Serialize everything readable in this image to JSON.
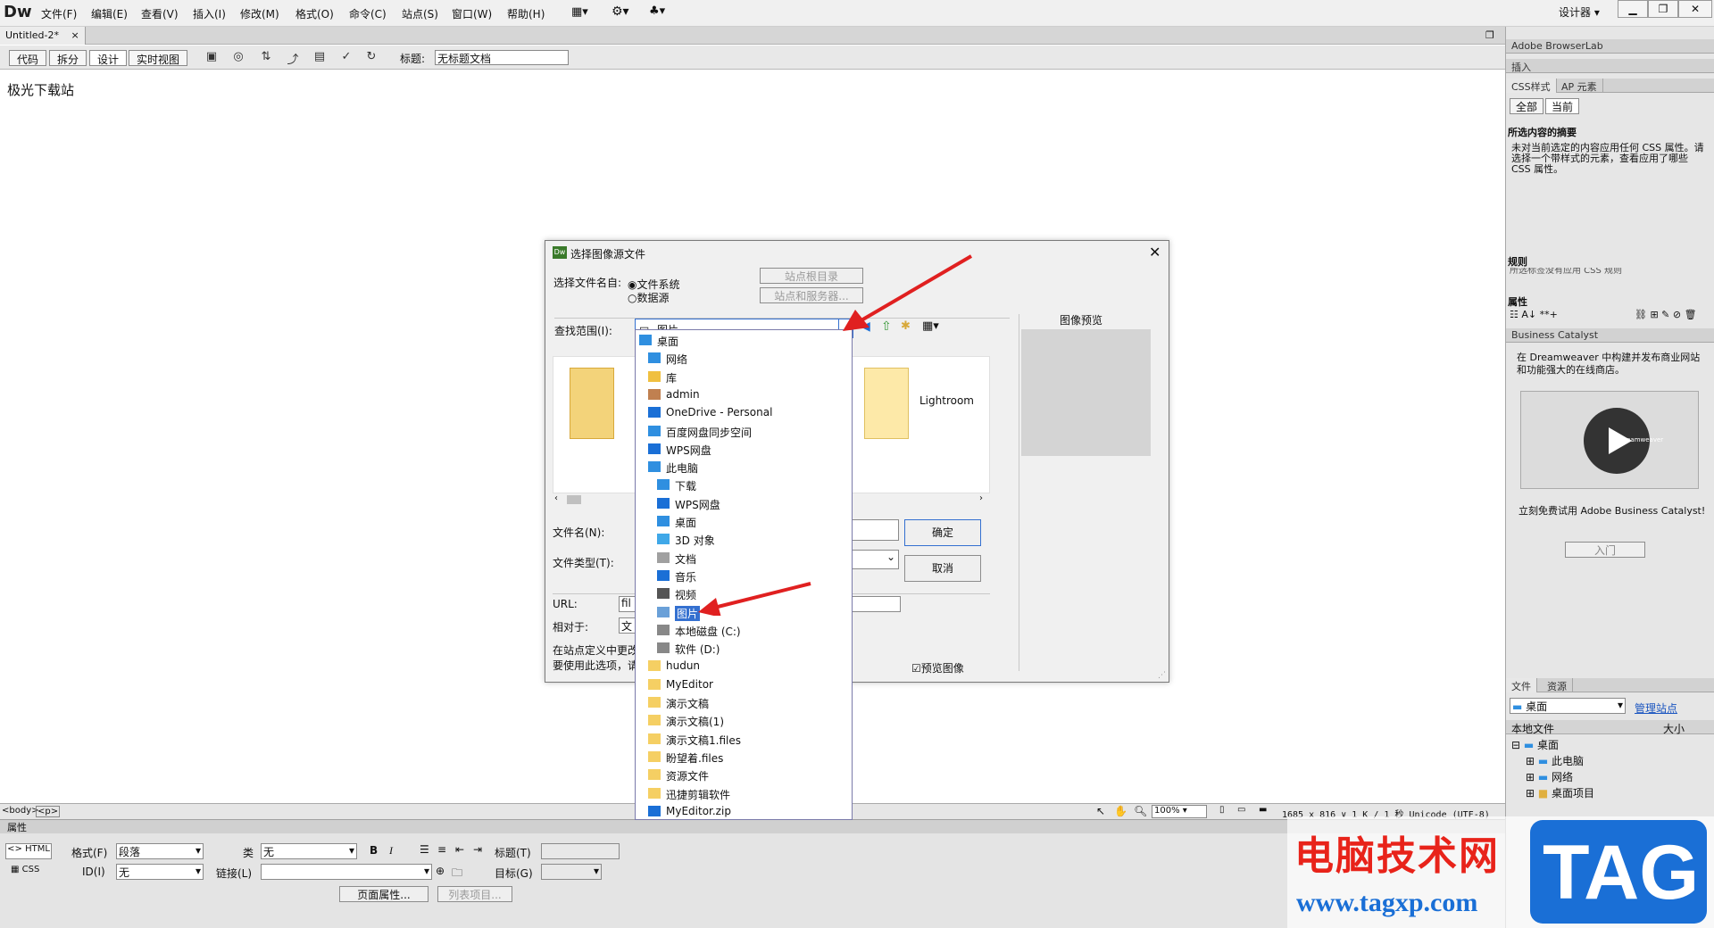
{
  "app": {
    "logo": "Dw",
    "menus": [
      "文件(F)",
      "编辑(E)",
      "查看(V)",
      "插入(I)",
      "修改(M)",
      "格式(O)",
      "命令(C)",
      "站点(S)",
      "窗口(W)",
      "帮助(H)"
    ],
    "workspace": "设计器",
    "doc_tab": "Untitled-2*",
    "view_buttons": [
      "代码",
      "拆分",
      "设计",
      "实时视图"
    ],
    "title_label": "标题:",
    "title_value": "无标题文档"
  },
  "canvas": {
    "text": "极光下载站"
  },
  "status_bar": {
    "tags": [
      "<body>",
      "<p>"
    ],
    "zoom": "100%",
    "info": "1685 x 816 ∨ 1 K / 1 秒 Unicode (UTF-8)"
  },
  "properties": {
    "title": "属性",
    "html_label": "HTML",
    "css_label": "CSS",
    "format_label": "格式(F)",
    "format_value": "段落",
    "class_label": "类",
    "class_value": "无",
    "id_label": "ID(I)",
    "id_value": "无",
    "link_label": "链接(L)",
    "title_label": "标题(T)",
    "target_label": "目标(G)",
    "bold": "B",
    "italic": "I",
    "page_props_button": "页面属性...",
    "list_item_button": "列表项目..."
  },
  "right_panel": {
    "browserlab": "Adobe BrowserLab",
    "insert": "插入",
    "css_tab": "CSS样式",
    "ap_tab": "AP 元素",
    "all_btn": "全部",
    "current_btn": "当前",
    "summary_title": "所选内容的摘要",
    "summary_text": "未对当前选定的内容应用任何 CSS 属性。请选择一个带样式的元素，查看应用了哪些 CSS 属性。",
    "rules_title": "规则",
    "rules_text": "所选标签没有应用 CSS 规则",
    "attr_title": "属性",
    "bc_title": "Business Catalyst",
    "bc_text": "在 Dreamweaver 中构建并发布商业网站和功能强大的在线商店。",
    "bc_video": "Dreamweaver",
    "bc_cta": "立刻免费试用 Adobe Business Catalyst!",
    "bc_button": "入门",
    "files_tab": "文件",
    "assets_tab": "资源",
    "location": "桌面",
    "manage_link": "管理站点",
    "col_local": "本地文件",
    "col_size": "大小",
    "tree": [
      "桌面",
      "此电脑",
      "网络",
      "桌面项目"
    ]
  },
  "dialog": {
    "title": "选择图像源文件",
    "choose_from": "选择文件名自:",
    "opt_filesystem": "文件系统",
    "opt_datasource": "数据源",
    "site_root_btn": "站点根目录",
    "site_server_btn": "站点和服务器...",
    "lookin_label": "查找范围(I):",
    "lookin_value": "图片",
    "preview_title": "图像预览",
    "folder_right": "Lightroom",
    "filename_label": "文件名(N):",
    "filetype_label": "文件类型(T):",
    "ok": "确定",
    "cancel": "取消",
    "url_label": "URL:",
    "url_value": "fil",
    "relative_label": "相对于:",
    "relative_value": "文",
    "note1": "在站点定义中更改",
    "note2": "要使用此选项，请",
    "preview_check": "预览图像",
    "dropdown": [
      {
        "label": "桌面",
        "icon": "desktop-icon",
        "indent": 0
      },
      {
        "label": "网络",
        "icon": "network-icon",
        "indent": 1
      },
      {
        "label": "库",
        "icon": "library-icon",
        "indent": 1
      },
      {
        "label": "admin",
        "icon": "user-icon",
        "indent": 1
      },
      {
        "label": "OneDrive - Personal",
        "icon": "cloud-icon",
        "indent": 1
      },
      {
        "label": "百度网盘同步空间",
        "icon": "baidu-icon",
        "indent": 1
      },
      {
        "label": "WPS网盘",
        "icon": "cloud-icon",
        "indent": 1
      },
      {
        "label": "此电脑",
        "icon": "computer-icon",
        "indent": 1
      },
      {
        "label": "下载",
        "icon": "download-icon",
        "indent": 2
      },
      {
        "label": "WPS网盘",
        "icon": "cloud-icon",
        "indent": 2
      },
      {
        "label": "桌面",
        "icon": "desktop-icon",
        "indent": 2
      },
      {
        "label": "3D 对象",
        "icon": "cube-icon",
        "indent": 2
      },
      {
        "label": "文档",
        "icon": "document-icon",
        "indent": 2
      },
      {
        "label": "音乐",
        "icon": "music-icon",
        "indent": 2
      },
      {
        "label": "视频",
        "icon": "video-icon",
        "indent": 2
      },
      {
        "label": "图片",
        "icon": "picture-icon",
        "indent": 2
      },
      {
        "label": "本地磁盘 (C:)",
        "icon": "drive-icon",
        "indent": 2
      },
      {
        "label": "软件 (D:)",
        "icon": "drive-icon",
        "indent": 2
      },
      {
        "label": "hudun",
        "icon": "folder-icon",
        "indent": 1
      },
      {
        "label": "MyEditor",
        "icon": "folder-icon",
        "indent": 1
      },
      {
        "label": "演示文稿",
        "icon": "folder-icon",
        "indent": 1
      },
      {
        "label": "演示文稿(1)",
        "icon": "folder-icon",
        "indent": 1
      },
      {
        "label": "演示文稿1.files",
        "icon": "folder-icon",
        "indent": 1
      },
      {
        "label": "盼望着.files",
        "icon": "folder-icon",
        "indent": 1
      },
      {
        "label": "资源文件",
        "icon": "folder-icon",
        "indent": 1
      },
      {
        "label": "迅捷剪辑软件",
        "icon": "folder-icon",
        "indent": 1
      },
      {
        "label": "MyEditor.zip",
        "icon": "zip-icon",
        "indent": 1
      }
    ]
  },
  "watermark": {
    "site": "电脑技术网",
    "url": "www.tagxp.com",
    "tag": "TAG"
  },
  "colors": {
    "accent": "#3470d0",
    "arrow": "#e02020",
    "watermark_red": "#e8231a",
    "watermark_blue": "#1a6fd6"
  }
}
